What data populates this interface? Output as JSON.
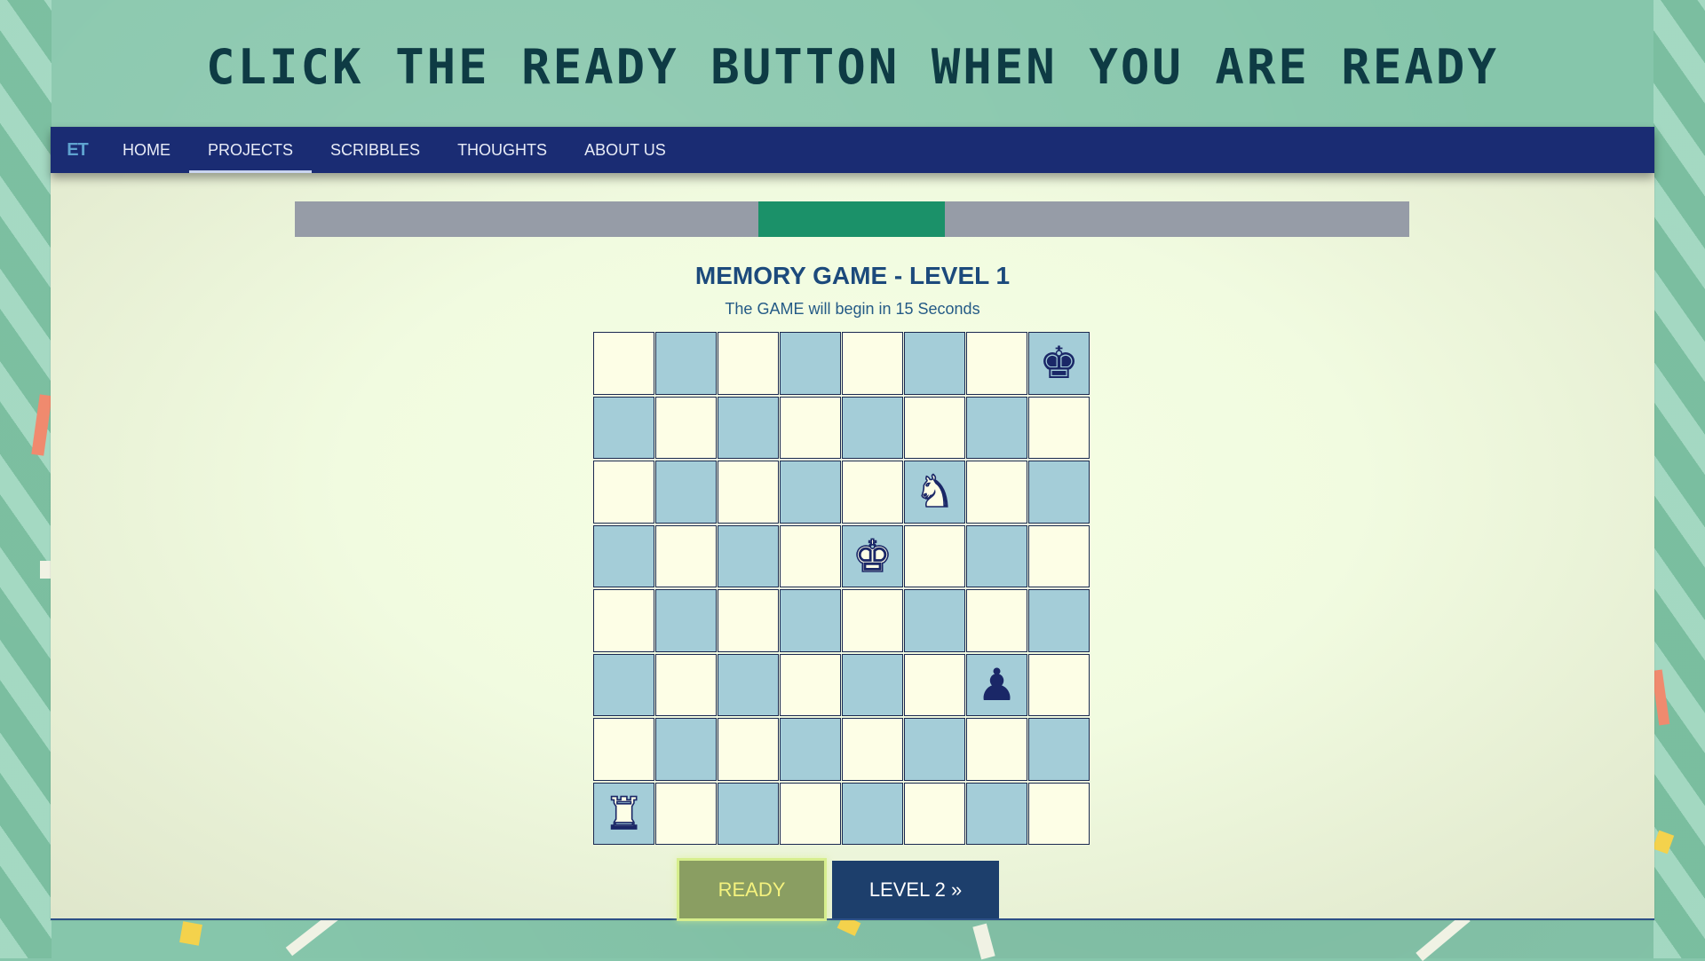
{
  "headline": "CLICK THE READY BUTTON WHEN YOU ARE READY",
  "navbar": {
    "logo": "ET",
    "items": [
      {
        "label": "HOME",
        "active": false
      },
      {
        "label": "PROJECTS",
        "active": true
      },
      {
        "label": "SCRIBBLES",
        "active": false
      },
      {
        "label": "THOUGHTS",
        "active": false
      },
      {
        "label": "ABOUT US",
        "active": false
      }
    ]
  },
  "timer": {
    "fill_start_fraction": 0.416,
    "fill_end_fraction": 0.583,
    "track_color": "#969ca7",
    "fill_color": "#1b9169"
  },
  "game": {
    "title": "MEMORY GAME - LEVEL 1",
    "subtitle": "The GAME will begin in 15 Seconds"
  },
  "board": {
    "size": 8,
    "light_color": "#fdfee6",
    "dark_color": "#a4cdd8",
    "pieces": [
      {
        "row": 0,
        "col": 7,
        "type": "king",
        "color": "black",
        "icon": "black-king-icon"
      },
      {
        "row": 2,
        "col": 5,
        "type": "knight",
        "color": "white",
        "icon": "white-knight-icon"
      },
      {
        "row": 3,
        "col": 4,
        "type": "king",
        "color": "white",
        "icon": "white-king-icon"
      },
      {
        "row": 5,
        "col": 6,
        "type": "pawn",
        "color": "black",
        "icon": "black-pawn-icon"
      },
      {
        "row": 7,
        "col": 0,
        "type": "rook",
        "color": "white",
        "icon": "white-rook-icon"
      }
    ]
  },
  "buttons": {
    "ready_label": "READY",
    "next_level_label": "LEVEL 2 »"
  }
}
